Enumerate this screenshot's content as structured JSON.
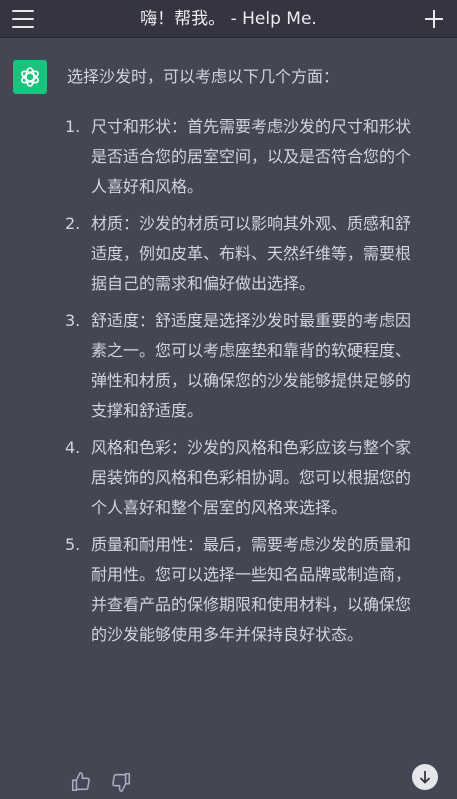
{
  "header": {
    "title": "嗨！帮我。 - Help Me.",
    "menu_icon": "hamburger-menu-icon",
    "new_chat_icon": "plus-icon"
  },
  "message": {
    "avatar_icon": "openai-logo-icon",
    "avatar_color": "#19c37d",
    "intro": "选择沙发时，可以考虑以下几个方面：",
    "items": [
      {
        "num": "1.",
        "text": "尺寸和形状：首先需要考虑沙发的尺寸和形状是否适合您的居室空间，以及是否符合您的个人喜好和风格。"
      },
      {
        "num": "2.",
        "text": "材质：沙发的材质可以影响其外观、质感和舒适度，例如皮革、布料、天然纤维等，需要根据自己的需求和偏好做出选择。"
      },
      {
        "num": "3.",
        "text": "舒适度：舒适度是选择沙发时最重要的考虑因素之一。您可以考虑座垫和靠背的软硬程度、弹性和材质，以确保您的沙发能够提供足够的支撑和舒适度。"
      },
      {
        "num": "4.",
        "text": "风格和色彩：沙发的风格和色彩应该与整个家居装饰的风格和色彩相协调。您可以根据您的个人喜好和整个居室的风格来选择。"
      },
      {
        "num": "5.",
        "text": "质量和耐用性：最后，需要考虑沙发的质量和耐用性。您可以选择一些知名品牌或制造商，并查看产品的保修期限和使用材料，以确保您的沙发能够使用多年并保持良好状态。"
      }
    ]
  },
  "actions": {
    "thumbs_up_icon": "thumbs-up-icon",
    "thumbs_down_icon": "thumbs-down-icon",
    "scroll_down_icon": "arrow-down-icon"
  },
  "colors": {
    "background": "#444654",
    "header": "#343541",
    "text": "#d1d5db"
  }
}
